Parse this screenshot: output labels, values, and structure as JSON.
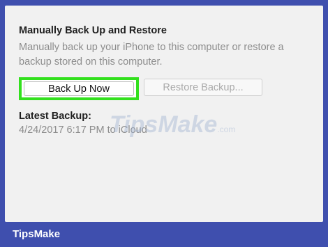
{
  "manual_backup": {
    "title": "Manually Back Up and Restore",
    "description": "Manually back up your iPhone to this computer or restore a backup stored on this computer.",
    "back_up_now_label": "Back Up Now",
    "restore_backup_label": "Restore Backup..."
  },
  "latest_backup": {
    "title": "Latest Backup:",
    "value": "4/24/2017 6:17 PM to iCloud"
  },
  "watermark": {
    "text": "TipsMake",
    "suffix": ".com"
  },
  "footer": {
    "brand": "TipsMake"
  },
  "colors": {
    "background": "#3f4fae",
    "panel": "#f1f1f1",
    "highlight": "#33e01e"
  }
}
